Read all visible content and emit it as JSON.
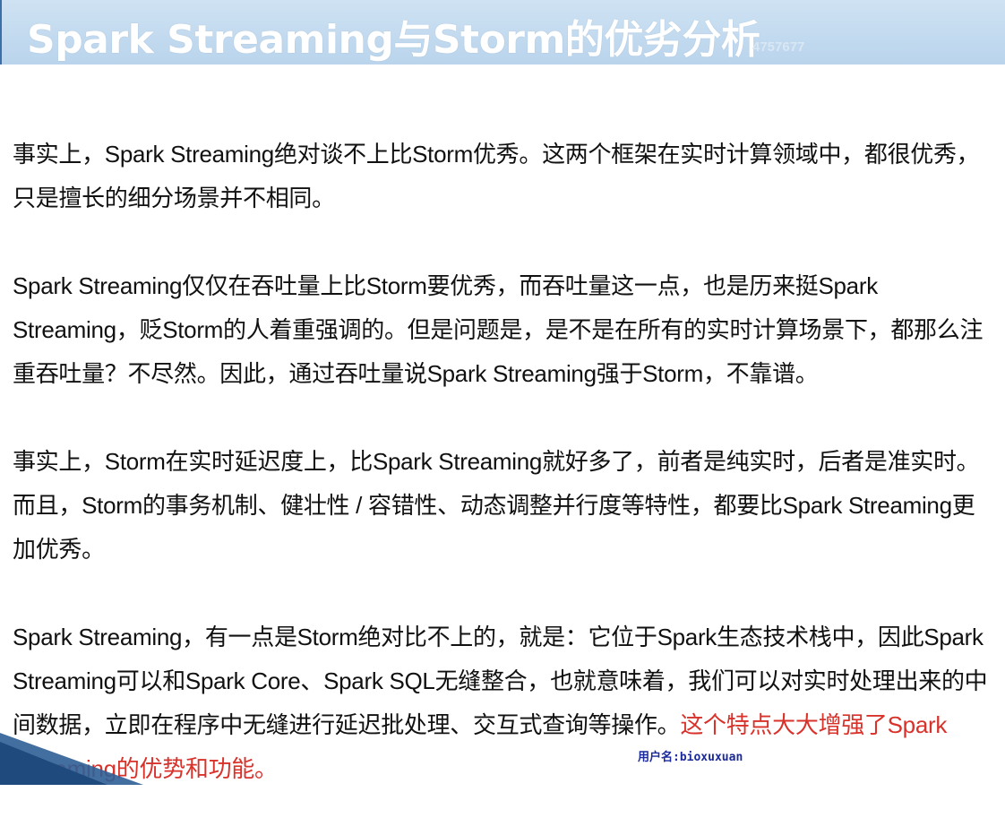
{
  "title": "Spark Streaming与Storm的优劣分析",
  "title_watermark": "4757677",
  "paragraphs": [
    "事实上，Spark Streaming绝对谈不上比Storm优秀。这两个框架在实时计算领域中，都很优秀，只是擅长的细分场景并不相同。",
    "Spark Streaming仅仅在吞吐量上比Storm要优秀，而吞吐量这一点，也是历来挺Spark Streaming，贬Storm的人着重强调的。但是问题是，是不是在所有的实时计算场景下，都那么注重吞吐量？不尽然。因此，通过吞吐量说Spark Streaming强于Storm，不靠谱。",
    "事实上，Storm在实时延迟度上，比Spark Streaming就好多了，前者是纯实时，后者是准实时。而且，Storm的事务机制、健壮性 / 容错性、动态调整并行度等特性，都要比Spark Streaming更加优秀。"
  ],
  "last_paragraph": {
    "normal": "Spark Streaming，有一点是Storm绝对比不上的，就是：它位于Spark生态技术栈中，因此Spark Streaming可以和Spark Core、Spark SQL无缝整合，也就意味着，我们可以对实时处理出来的中间数据，立即在程序中无缝进行延迟批处理、交互式查询等操作。",
    "highlight": "这个特点大大增强了Spark Streaming的优势和功能。"
  },
  "user_label": "用户名:bioxuxuan",
  "colors": {
    "title_bar": "#c5dcf0",
    "title_text": "#ffffff",
    "highlight": "#d8322b",
    "user_label": "#1a2a9a",
    "corner_bar": "#2f5f96"
  }
}
